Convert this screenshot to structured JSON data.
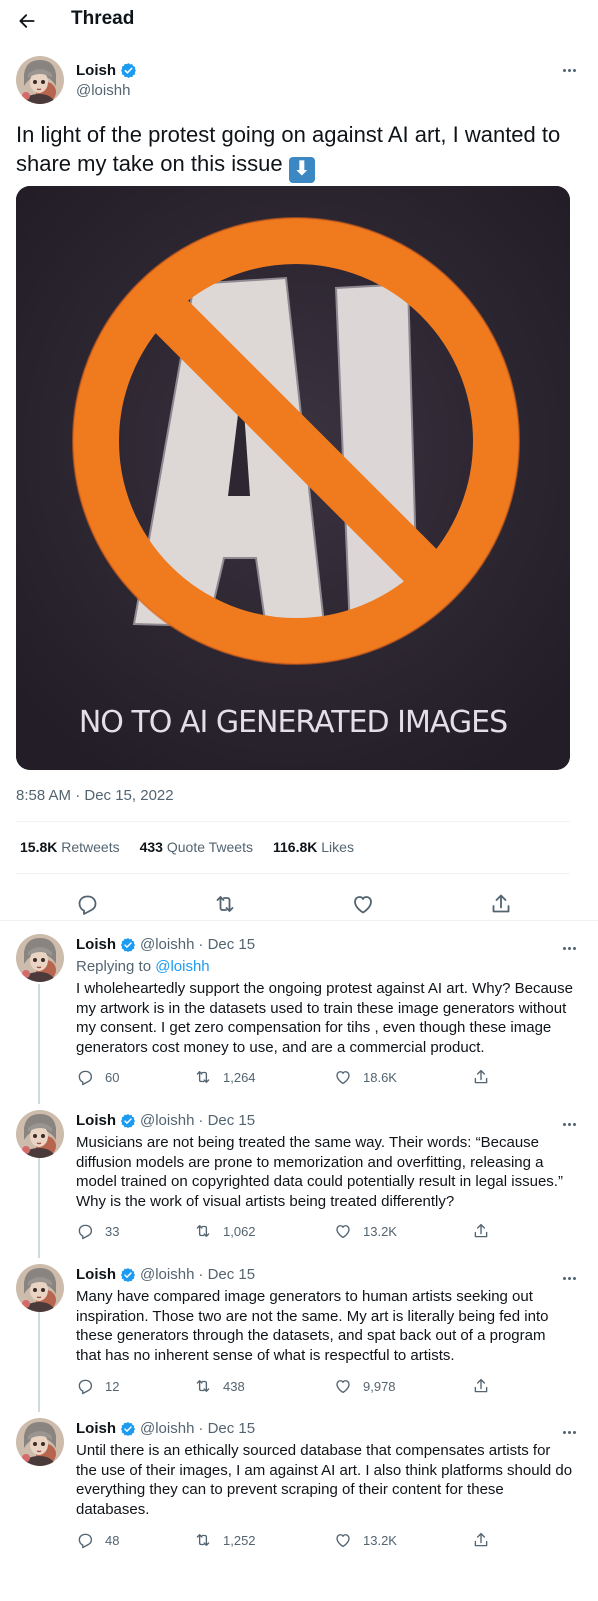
{
  "header": {
    "title": "Thread",
    "back_icon": "arrow-left-icon"
  },
  "main_tweet": {
    "author_name": "Loish",
    "author_handle": "@loishh",
    "verified": true,
    "text": "In light of the protest going on against AI art, I wanted to share my take on this issue",
    "emoji": "⬇",
    "image": {
      "letters": "AI",
      "caption": "NO TO AI GENERATED IMAGES"
    },
    "timestamp": "8:58 AM · Dec 15, 2022",
    "stats": {
      "retweets_count": "15.8K",
      "retweets_label": "Retweets",
      "quotes_count": "433",
      "quotes_label": "Quote Tweets",
      "likes_count": "116.8K",
      "likes_label": "Likes"
    }
  },
  "replies": [
    {
      "name": "Loish",
      "handle": "@loishh",
      "date": "· Dec 15",
      "replying_to_prefix": "Replying to",
      "replying_to_handle": "@loishh",
      "text": "I wholeheartedly support the ongoing protest against AI art. Why? Because my artwork is in the datasets used to train these image generators without my consent. I get zero compensation for tihs , even though these image generators cost money to use, and are a commercial product.",
      "replies": "60",
      "retweets": "1,264",
      "likes": "18.6K"
    },
    {
      "name": "Loish",
      "handle": "@loishh",
      "date": "· Dec 15",
      "text": "Musicians are not being treated the same way. Their words: “Because diffusion models are prone to memorization and overfitting, releasing a model trained on copyrighted data could potentially result in legal issues.” Why is the work of visual artists being treated differently?",
      "replies": "33",
      "retweets": "1,062",
      "likes": "13.2K"
    },
    {
      "name": "Loish",
      "handle": "@loishh",
      "date": "· Dec 15",
      "text": "Many have compared image generators to human artists seeking out inspiration. Those two are not the same. My art is literally being fed into these generators through the datasets, and spat back out of a program that has no inherent sense of what is respectful to artists.",
      "replies": "12",
      "retweets": "438",
      "likes": "9,978"
    },
    {
      "name": "Loish",
      "handle": "@loishh",
      "date": "· Dec 15",
      "text": "Until there is an ethically sourced database that compensates artists for the use of their images, I am against AI art. I also think platforms should do everything they can to prevent scraping of their content for these databases.",
      "replies": "48",
      "retweets": "1,252",
      "likes": "13.2K"
    }
  ],
  "colors": {
    "accent": "#1d9bf0",
    "secondary_text": "#536471",
    "primary_text": "#0f1419",
    "verified": "#1d9bf0",
    "sign_orange": "#f07a1e"
  }
}
